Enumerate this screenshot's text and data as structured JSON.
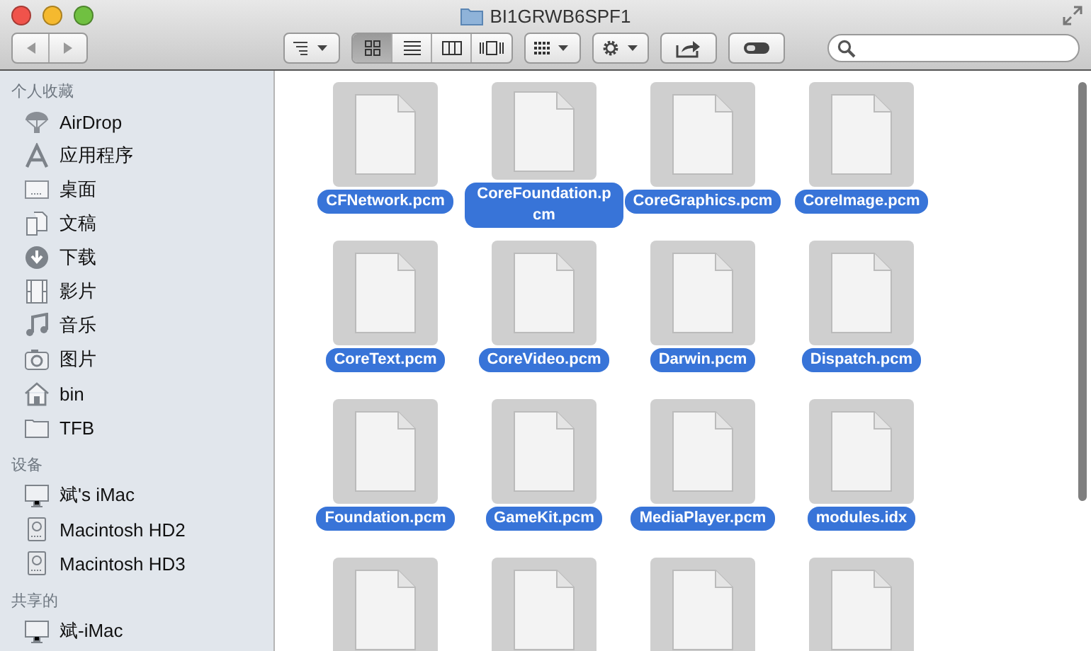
{
  "window": {
    "title": "BI1GRWB6SPF1"
  },
  "toolbar": {
    "view_buttons": [
      {
        "kind": "icons",
        "selected": true
      },
      {
        "kind": "list",
        "selected": false
      },
      {
        "kind": "columns",
        "selected": false
      },
      {
        "kind": "coverflow",
        "selected": false
      }
    ]
  },
  "sidebar": {
    "sections": [
      {
        "title": "个人收藏",
        "items": [
          {
            "label": "AirDrop",
            "kind": "airdrop"
          },
          {
            "label": "应用程序",
            "kind": "apps"
          },
          {
            "label": "桌面",
            "kind": "desktop"
          },
          {
            "label": "文稿",
            "kind": "documents"
          },
          {
            "label": "下载",
            "kind": "downloads"
          },
          {
            "label": "影片",
            "kind": "movies"
          },
          {
            "label": "音乐",
            "kind": "music"
          },
          {
            "label": "图片",
            "kind": "pictures"
          },
          {
            "label": "bin",
            "kind": "home"
          },
          {
            "label": "TFB",
            "kind": "folder"
          }
        ]
      },
      {
        "title": "设备",
        "items": [
          {
            "label": "斌's iMac",
            "kind": "imac"
          },
          {
            "label": "Macintosh HD2",
            "kind": "disk"
          },
          {
            "label": "Macintosh HD3",
            "kind": "disk"
          }
        ]
      },
      {
        "title": "共享的",
        "items": [
          {
            "label": "斌-iMac",
            "kind": "imac"
          }
        ]
      }
    ]
  },
  "files": [
    {
      "name": "CFNetwork.pcm",
      "selected": true
    },
    {
      "name": "CoreFoundation.pcm",
      "selected": true
    },
    {
      "name": "CoreGraphics.pcm",
      "selected": true
    },
    {
      "name": "CoreImage.pcm",
      "selected": true
    },
    {
      "name": "CoreText.pcm",
      "selected": true
    },
    {
      "name": "CoreVideo.pcm",
      "selected": true
    },
    {
      "name": "Darwin.pcm",
      "selected": true
    },
    {
      "name": "Dispatch.pcm",
      "selected": true
    },
    {
      "name": "Foundation.pcm",
      "selected": true
    },
    {
      "name": "GameKit.pcm",
      "selected": true
    },
    {
      "name": "MediaPlayer.pcm",
      "selected": true
    },
    {
      "name": "modules.idx",
      "selected": true
    },
    {
      "selected": true
    },
    {
      "selected": true
    },
    {
      "selected": true
    },
    {
      "selected": true
    }
  ]
}
